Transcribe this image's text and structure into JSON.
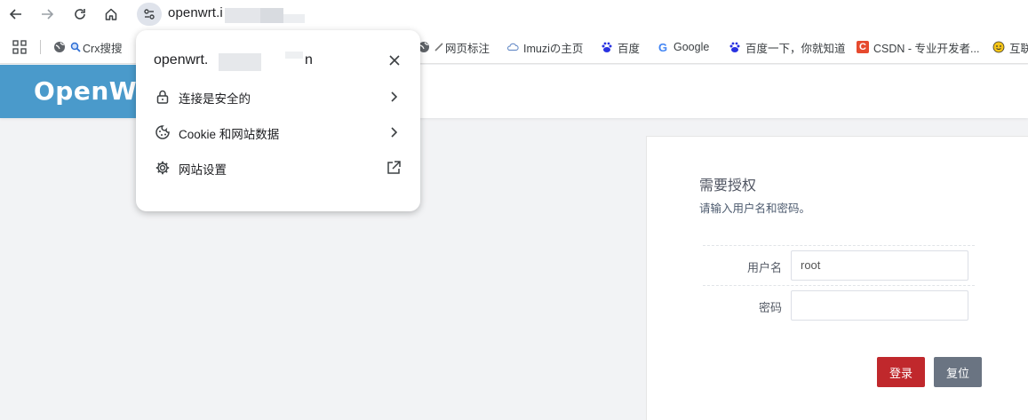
{
  "browser": {
    "url_text": "openwrt.i",
    "bookmarks": [
      {
        "label": "Crx搜搜",
        "icon": "search-icon"
      },
      {
        "label": "网页标注",
        "icon": "pencil-icon"
      },
      {
        "label": "Imuziの主页",
        "icon": "cloud-icon"
      },
      {
        "label": "百度",
        "icon": "baidu-paw-icon"
      },
      {
        "label": "Google",
        "icon": "google-g-icon"
      },
      {
        "label": "百度一下，你就知道",
        "icon": "baidu-paw-icon"
      },
      {
        "label": "CSDN - 专业开发者...",
        "icon": "csdn-c-icon"
      },
      {
        "label": "互联",
        "icon": "smiley-icon"
      }
    ],
    "csdn_icon_letter": "C",
    "google_icon_letter": "G"
  },
  "openwrt": {
    "brand": "OpenWrt"
  },
  "login": {
    "title": "需要授权",
    "subtitle": "请输入用户名和密码。",
    "username_label": "用户名",
    "username_value": "root",
    "password_label": "密码",
    "password_value": "",
    "login_button": "登录",
    "reset_button": "复位"
  },
  "popup": {
    "title": "openwrt.",
    "title_tail": "n",
    "items": [
      {
        "label": "连接是安全的",
        "icon": "lock-icon",
        "action": "chevron-right-icon"
      },
      {
        "label": "Cookie 和网站数据",
        "icon": "cookie-icon",
        "action": "chevron-right-icon"
      },
      {
        "label": "网站设置",
        "icon": "gear-icon",
        "action": "open-external-icon"
      }
    ]
  }
}
